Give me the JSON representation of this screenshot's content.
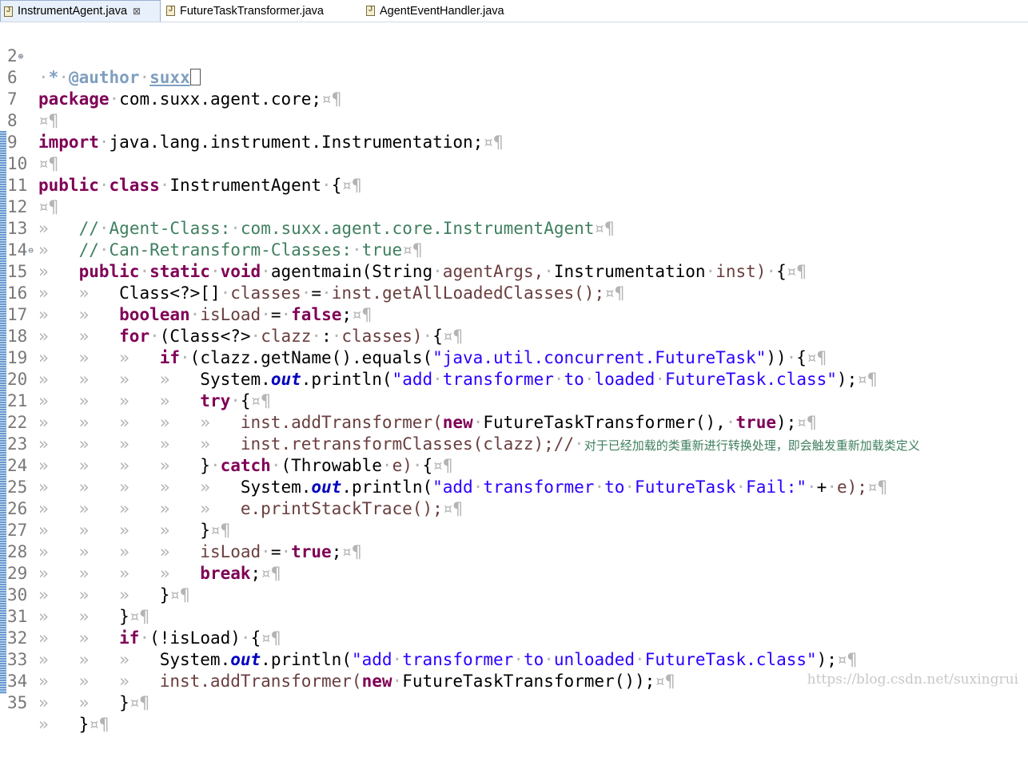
{
  "tabs": [
    {
      "label": "InstrumentAgent.java",
      "close": "⊠"
    },
    {
      "label": "FutureTaskTransformer.java"
    },
    {
      "label": "AgentEventHandler.java"
    }
  ],
  "editor": {
    "lines": [
      {
        "n": "2",
        "marker": "⊕"
      },
      {
        "n": "6"
      },
      {
        "n": "7"
      },
      {
        "n": "8"
      },
      {
        "n": "9"
      },
      {
        "n": "10"
      },
      {
        "n": "11"
      },
      {
        "n": "12"
      },
      {
        "n": "13"
      },
      {
        "n": "14",
        "marker": "⊖"
      },
      {
        "n": "15"
      },
      {
        "n": "16"
      },
      {
        "n": "17"
      },
      {
        "n": "18"
      },
      {
        "n": "19"
      },
      {
        "n": "20"
      },
      {
        "n": "21"
      },
      {
        "n": "22"
      },
      {
        "n": "23"
      },
      {
        "n": "24"
      },
      {
        "n": "25"
      },
      {
        "n": "26"
      },
      {
        "n": "27"
      },
      {
        "n": "28"
      },
      {
        "n": "29"
      },
      {
        "n": "30"
      },
      {
        "n": "31"
      },
      {
        "n": "32"
      },
      {
        "n": "33"
      },
      {
        "n": "34"
      },
      {
        "n": "35"
      }
    ],
    "t": {
      "author_tag": "@author",
      "author_name": "suxx",
      "pkg": "package",
      "pkg_name": "com.suxx.agent.core;",
      "imp": "import",
      "imp_name": "java.lang.instrument.Instrumentation;",
      "pub": "public",
      "cls": "class",
      "cls_name": "InstrumentAgent",
      "c12a": "//",
      "c12b": "Agent-Class:",
      "c12c": "com.suxx.agent.core.InstrumentAgent",
      "c13a": "//",
      "c13b": "Can-Retransform-Classes:",
      "c13c": "true",
      "static": "static",
      "void": "void",
      "agentmain": "agentmain(String",
      "agentArgs": "agentArgs,",
      "instType": "Instrumentation",
      "inst": "inst)",
      "classArr": "Class<?>[]",
      "classesVar": "classes",
      "getAll": "inst.getAllLoadedClasses();",
      "boolean": "boolean",
      "isLoad": "isLoad",
      "false": "false",
      "for": "for",
      "forClass": "(Class<?>",
      "clazz": "clazz",
      "classesEnd": "classes)",
      "if": "if",
      "getName": "(clazz.getName().equals(",
      "futureStr": "\"java.util.concurrent.FutureTask\"",
      "sysout": "System.",
      "out": "out",
      "println": ".println(",
      "str19a": "\"add",
      "str19b": "transformer",
      "str19c": "to",
      "str19d": "loaded",
      "str19e": "FutureTask.class\"",
      "try": "try",
      "inst21": "inst.addTransformer(",
      "new": "new",
      "ftt": "FutureTaskTransformer(),",
      "true": "true",
      "inst22": "inst.retransformClasses(clazz);//",
      "zh22": "对于已经加载的类重新进行转换处理，即会触发重新加载类定义",
      "catch": "catch",
      "throwable": "(Throwable",
      "eVar": "e)",
      "str24a": "\"add",
      "str24b": "transformer",
      "str24c": "to",
      "str24d": "FutureTask",
      "str24e": "Fail:\"",
      "plus": "+",
      "eEnd": "e);",
      "eprint": "e.printStackTrace();",
      "break": "break",
      "notLoad": "(!isLoad)",
      "str32a": "\"add",
      "str32b": "transformer",
      "str32c": "to",
      "str32d": "unloaded",
      "str32e": "FutureTask.class\"",
      "inst33": "inst.addTransformer(",
      "ftt33": "FutureTaskTransformer());"
    }
  },
  "watermark": "https://blog.csdn.net/suxingrui"
}
